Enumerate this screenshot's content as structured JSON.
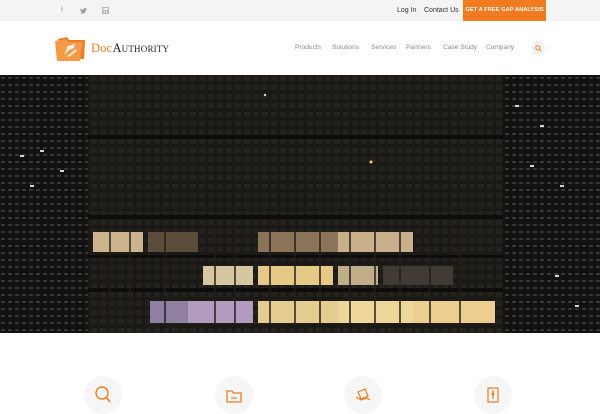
{
  "topbar": {
    "social": [
      {
        "icon": "facebook-icon",
        "glyph": "f"
      },
      {
        "icon": "twitter-icon",
        "glyph": "t"
      },
      {
        "icon": "linkedin-icon",
        "glyph": "in"
      }
    ],
    "login_label": "Log In",
    "contact_label": "Contact Us",
    "cta_label": "GET A FREE GAP ANALYSIS"
  },
  "brand": {
    "name_part1": "Doc",
    "name_part2": "Authority",
    "accent_color": "#f07b21"
  },
  "nav": {
    "items": [
      "Products",
      "Solutions",
      "Services",
      "Partners",
      "Case Study",
      "Company"
    ],
    "search_icon": "search-icon"
  },
  "hero": {
    "image_subject": "office building at night",
    "background_color": "#151311"
  },
  "features": {
    "icons": [
      "magnifier-icon",
      "folder-icon",
      "documents-hand-icon",
      "timeline-icon"
    ]
  }
}
